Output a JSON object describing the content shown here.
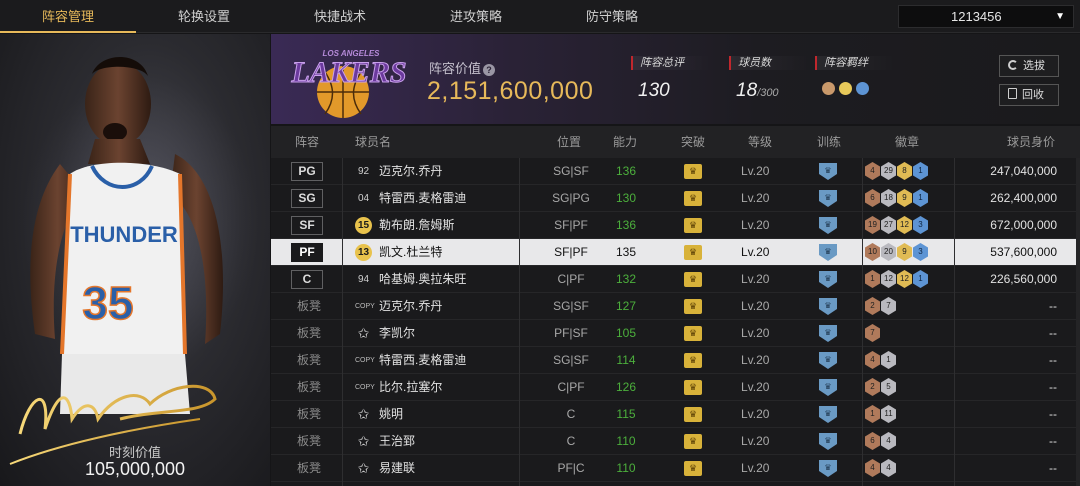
{
  "nav": {
    "tabs": [
      "阵容管理",
      "轮换设置",
      "快捷战术",
      "进攻策略",
      "防守策略"
    ],
    "active_tab": "阵容管理",
    "account": "1213456"
  },
  "card": {
    "value_label": "时刻价值",
    "value": "105,000,000",
    "jersey_team": "THUNDER",
    "jersey_number": "35"
  },
  "team": {
    "logo_text": "LAKERS",
    "logo_subtext": "LOS ANGELES",
    "lineup_value_label": "阵容价值",
    "lineup_value": "2,151,600,000",
    "rating_label": "阵容总评",
    "rating": "130",
    "player_count_label": "球员数",
    "player_count": "18",
    "player_count_max": "/300",
    "chemistry_label": "阵容羁绊",
    "select_button": "选拔",
    "recycle_button": "回收"
  },
  "table": {
    "headers": [
      "阵容",
      "球员名",
      "位置",
      "能力",
      "突破",
      "等级",
      "训练",
      "徽章",
      "球员身价"
    ],
    "rows": [
      {
        "slot": "PG",
        "bench": false,
        "num": "92",
        "num_style": "plain",
        "name": "迈克尔.乔丹",
        "pos": "SG|SF",
        "rating": "136",
        "level": "Lv.20",
        "badges": [
          [
            "4",
            "bronze"
          ],
          [
            "29",
            "silver"
          ],
          [
            "8",
            "gold"
          ],
          [
            "1",
            "blue"
          ]
        ],
        "value": "247,040,000"
      },
      {
        "slot": "SG",
        "bench": false,
        "num": "04",
        "num_style": "plain",
        "name": "特雷西.麦格雷迪",
        "pos": "SG|PG",
        "rating": "130",
        "level": "Lv.20",
        "badges": [
          [
            "6",
            "bronze"
          ],
          [
            "18",
            "silver"
          ],
          [
            "9",
            "gold"
          ],
          [
            "1",
            "blue"
          ]
        ],
        "value": "262,400,000"
      },
      {
        "slot": "SF",
        "bench": false,
        "num": "15",
        "num_style": "gold",
        "name": "勒布朗.詹姆斯",
        "pos": "SF|PF",
        "rating": "136",
        "level": "Lv.20",
        "badges": [
          [
            "19",
            "bronze"
          ],
          [
            "27",
            "silver"
          ],
          [
            "12",
            "gold"
          ],
          [
            "3",
            "blue"
          ]
        ],
        "value": "672,000,000"
      },
      {
        "slot": "PF",
        "bench": false,
        "selected": true,
        "num": "13",
        "num_style": "gold",
        "name": "凯文.杜兰特",
        "pos": "SF|PF",
        "rating": "135",
        "level": "Lv.20",
        "badges": [
          [
            "10",
            "bronze"
          ],
          [
            "20",
            "silver"
          ],
          [
            "9",
            "gold"
          ],
          [
            "3",
            "blue"
          ]
        ],
        "value": "537,600,000"
      },
      {
        "slot": "C",
        "bench": false,
        "num": "94",
        "num_style": "plain",
        "name": "哈基姆.奥拉朱旺",
        "pos": "C|PF",
        "rating": "132",
        "level": "Lv.20",
        "badges": [
          [
            "1",
            "bronze"
          ],
          [
            "12",
            "silver"
          ],
          [
            "12",
            "gold"
          ],
          [
            "1",
            "blue"
          ]
        ],
        "value": "226,560,000"
      },
      {
        "slot": "板凳",
        "bench": true,
        "num": "COPY",
        "num_style": "copy",
        "name": "迈克尔.乔丹",
        "pos": "SG|SF",
        "rating": "127",
        "level": "Lv.20",
        "badges": [
          [
            "2",
            "bronze"
          ],
          [
            "7",
            "silver"
          ]
        ],
        "value": "--"
      },
      {
        "slot": "板凳",
        "bench": true,
        "num": "✩",
        "num_style": "star",
        "name": "李凯尔",
        "pos": "PF|SF",
        "rating": "105",
        "level": "Lv.20",
        "badges": [
          [
            "7",
            "bronze"
          ]
        ],
        "value": "--"
      },
      {
        "slot": "板凳",
        "bench": true,
        "num": "COPY",
        "num_style": "copy",
        "name": "特雷西.麦格雷迪",
        "pos": "SG|SF",
        "rating": "114",
        "level": "Lv.20",
        "badges": [
          [
            "4",
            "bronze"
          ],
          [
            "1",
            "silver"
          ]
        ],
        "value": "--"
      },
      {
        "slot": "板凳",
        "bench": true,
        "num": "COPY",
        "num_style": "copy",
        "name": "比尔.拉塞尔",
        "pos": "C|PF",
        "rating": "126",
        "level": "Lv.20",
        "badges": [
          [
            "2",
            "bronze"
          ],
          [
            "5",
            "silver"
          ]
        ],
        "value": "--"
      },
      {
        "slot": "板凳",
        "bench": true,
        "num": "✩",
        "num_style": "star",
        "name": "姚明",
        "pos": "C",
        "rating": "115",
        "level": "Lv.20",
        "badges": [
          [
            "1",
            "bronze"
          ],
          [
            "11",
            "silver"
          ]
        ],
        "value": "--"
      },
      {
        "slot": "板凳",
        "bench": true,
        "num": "✩",
        "num_style": "star",
        "name": "王治郅",
        "pos": "C",
        "rating": "110",
        "level": "Lv.20",
        "badges": [
          [
            "6",
            "bronze"
          ],
          [
            "4",
            "silver"
          ]
        ],
        "value": "--"
      },
      {
        "slot": "板凳",
        "bench": true,
        "num": "✩",
        "num_style": "star",
        "name": "易建联",
        "pos": "PF|C",
        "rating": "110",
        "level": "Lv.20",
        "badges": [
          [
            "4",
            "bronze"
          ],
          [
            "4",
            "silver"
          ]
        ],
        "value": "--"
      }
    ]
  },
  "colors": {
    "accent": "#e7b95a",
    "rating_green": "#4caf3c",
    "stat_marker": "#c0272d"
  }
}
